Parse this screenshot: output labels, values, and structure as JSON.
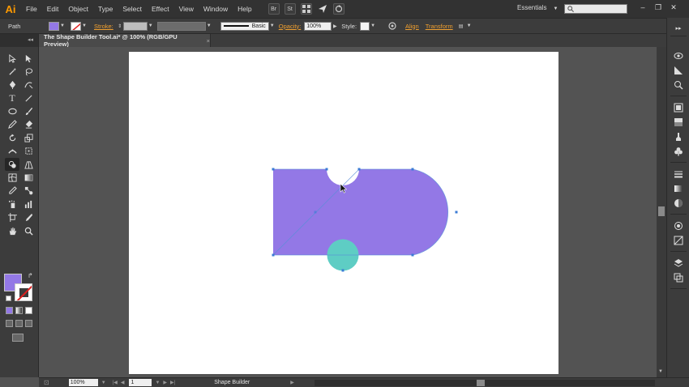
{
  "app": {
    "logo": "Ai"
  },
  "menu": [
    "File",
    "Edit",
    "Object",
    "Type",
    "Select",
    "Effect",
    "View",
    "Window",
    "Help"
  ],
  "menu_icons": [
    "bridge-icon",
    "stock-icon",
    "arrange-documents-icon",
    "send-icon",
    "sync-icon"
  ],
  "menu_icon_text": {
    "bridge": "Br",
    "stock": "St"
  },
  "workspace": {
    "label": "Essentials"
  },
  "window_controls": {
    "minimize": "–",
    "restore": "❐",
    "close": "✕"
  },
  "control_bar": {
    "selection_label": "Path",
    "fill_color": "#9378e6",
    "stroke_label": "Stroke:",
    "brush_label": "Basic",
    "opacity_label": "Opacity:",
    "opacity_value": "100%",
    "style_label": "Style:",
    "align_label": "Align",
    "transform_label": "Transform"
  },
  "document": {
    "tab_title": "The Shape Builder Tool.ai* @ 100% (RGB/GPU Preview)",
    "tab_close": "×"
  },
  "toolbar": {
    "fill_color": "#9378e6",
    "stroke": "none"
  },
  "canvas": {
    "artboard_color": "#ffffff",
    "shapes": [
      {
        "name": "purple-merged-shape",
        "fill": "#9378e6"
      },
      {
        "name": "teal-circle",
        "fill": "#5ecdc4"
      }
    ],
    "selection_color": "#3a7bd5"
  },
  "status_bar": {
    "zoom": "100%",
    "page": "1",
    "current_tool": "Shape Builder"
  }
}
